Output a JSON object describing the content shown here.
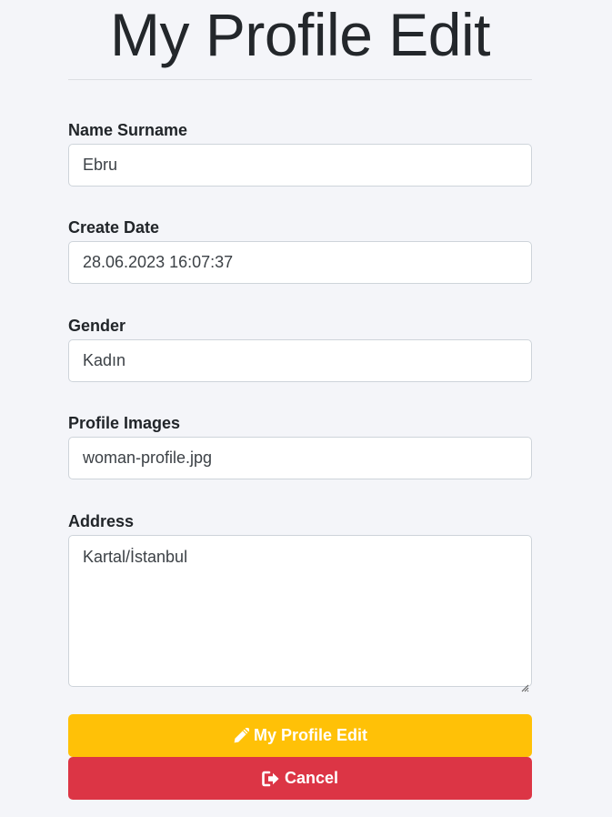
{
  "page": {
    "title": "My Profile Edit"
  },
  "form": {
    "name": {
      "label": "Name Surname",
      "value": "Ebru"
    },
    "create_date": {
      "label": "Create Date",
      "value": "28.06.2023 16:07:37"
    },
    "gender": {
      "label": "Gender",
      "value": "Kadın"
    },
    "profile_images": {
      "label": "Profile Images",
      "value": "woman-profile.jpg"
    },
    "address": {
      "label": "Address",
      "value": "Kartal/İstanbul"
    }
  },
  "actions": {
    "edit": {
      "label": "My Profile Edit",
      "icon": "pencil-icon",
      "color": "#ffc107"
    },
    "cancel": {
      "label": "Cancel",
      "icon": "sign-out-icon",
      "color": "#dc3545"
    }
  }
}
